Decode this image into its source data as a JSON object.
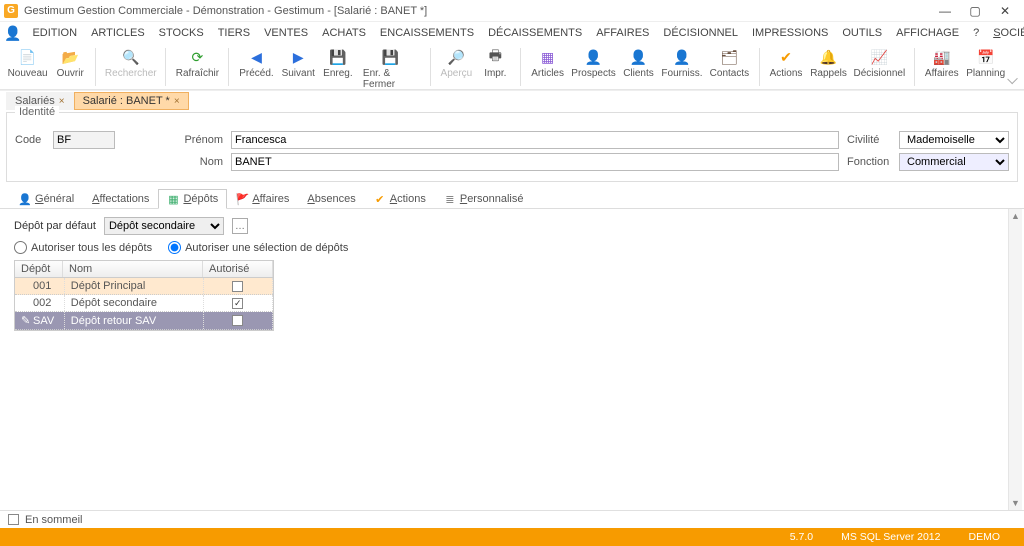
{
  "title": "Gestimum Gestion Commerciale - Démonstration - Gestimum - [Salarié : BANET *]",
  "app_icon_letter": "G",
  "menu": [
    "SOCIÉTÉ",
    "EDITION",
    "ARTICLES",
    "STOCKS",
    "TIERS",
    "VENTES",
    "ACHATS",
    "ENCAISSEMENTS",
    "DÉCAISSEMENTS",
    "AFFAIRES",
    "DÉCISIONNEL",
    "IMPRESSIONS",
    "OUTILS",
    "AFFICHAGE",
    "?"
  ],
  "toolbar": [
    {
      "label": "Nouveau",
      "icon": "📄",
      "on": true
    },
    {
      "label": "Ouvrir",
      "icon": "📂",
      "on": true
    },
    {
      "sep": true
    },
    {
      "label": "Rechercher",
      "icon": "🔍",
      "on": false
    },
    {
      "sep": true
    },
    {
      "label": "Rafraîchir",
      "icon": "⟳",
      "on": true,
      "color": "#2e9e2e"
    },
    {
      "sep": true
    },
    {
      "label": "Précéd.",
      "icon": "◀",
      "on": true,
      "color": "#2c6fdc"
    },
    {
      "label": "Suivant",
      "icon": "▶",
      "on": true,
      "color": "#2c6fdc"
    },
    {
      "label": "Enreg.",
      "icon": "💾",
      "on": true
    },
    {
      "label": "Enr. & Fermer",
      "icon": "💾",
      "on": true
    },
    {
      "sep": true
    },
    {
      "label": "Aperçu",
      "icon": "🔎",
      "on": false
    },
    {
      "label": "Impr.",
      "icon": "🖶",
      "on": true
    },
    {
      "sep": true
    },
    {
      "label": "Articles",
      "icon": "▦",
      "on": true,
      "color": "#8a5bd6"
    },
    {
      "label": "Prospects",
      "icon": "👤",
      "on": true,
      "color": "#2e9e2e"
    },
    {
      "label": "Clients",
      "icon": "👤",
      "on": true,
      "color": "#2c6fdc"
    },
    {
      "label": "Fourniss.",
      "icon": "👤",
      "on": true,
      "color": "#e03a3a"
    },
    {
      "label": "Contacts",
      "icon": "🗂",
      "on": true,
      "color": "#6a5140"
    },
    {
      "sep": true
    },
    {
      "label": "Actions",
      "icon": "✔",
      "on": true,
      "color": "#f79b00"
    },
    {
      "label": "Rappels",
      "icon": "🔔",
      "on": true,
      "color": "#f79b00"
    },
    {
      "label": "Décisionnel",
      "icon": "📈",
      "on": true,
      "color": "#2e9e2e"
    },
    {
      "sep": true
    },
    {
      "label": "Affaires",
      "icon": "🏭",
      "on": true,
      "color": "#d06050"
    },
    {
      "label": "Planning",
      "icon": "📅",
      "on": true,
      "color": "#2c6fdc"
    }
  ],
  "doc_tabs": [
    {
      "label": "Salariés",
      "active": false
    },
    {
      "label": "Salarié : BANET *",
      "active": true
    }
  ],
  "identity": {
    "legend": "Identité",
    "code_label": "Code",
    "code": "BF",
    "prenom_label": "Prénom",
    "prenom": "Francesca",
    "nom_label": "Nom",
    "nom": "BANET",
    "civilite_label": "Civilité",
    "civilite": "Mademoiselle",
    "fonction_label": "Fonction",
    "fonction": "Commercial"
  },
  "subtabs": [
    {
      "label": "Général",
      "icon": "👤",
      "color": "#f79b00"
    },
    {
      "label": "Affectations",
      "icon": ""
    },
    {
      "label": "Dépôts",
      "icon": "▦",
      "color": "#3a6",
      "active": true
    },
    {
      "label": "Affaires",
      "icon": "🚩",
      "color": "#d06050"
    },
    {
      "label": "Absences",
      "icon": ""
    },
    {
      "label": "Actions",
      "icon": "✔",
      "color": "#f79b00"
    },
    {
      "label": "Personnalisé",
      "icon": "≣",
      "color": "#888"
    }
  ],
  "depots": {
    "default_label": "Dépôt par défaut",
    "default_value": "Dépôt secondaire",
    "ellipsis": "…",
    "opt_all": "Autoriser tous les dépôts",
    "opt_sel": "Autoriser une sélection de dépôts",
    "opt_selected": "sel",
    "headers": {
      "c1": "Dépôt",
      "c2": "Nom",
      "c3": "Autorisé"
    },
    "rows": [
      {
        "code": "001",
        "nom": "Dépôt Principal",
        "auth": false,
        "cls": "r1"
      },
      {
        "code": "002",
        "nom": "Dépôt secondaire",
        "auth": true,
        "cls": "r2"
      },
      {
        "code": "SAV",
        "nom": "Dépôt retour SAV",
        "auth": false,
        "cls": "r3",
        "mark": "✎"
      }
    ]
  },
  "footer": {
    "sommeil": "En sommeil",
    "version": "5.7.0",
    "db": "MS SQL Server 2012",
    "env": "DEMO"
  }
}
